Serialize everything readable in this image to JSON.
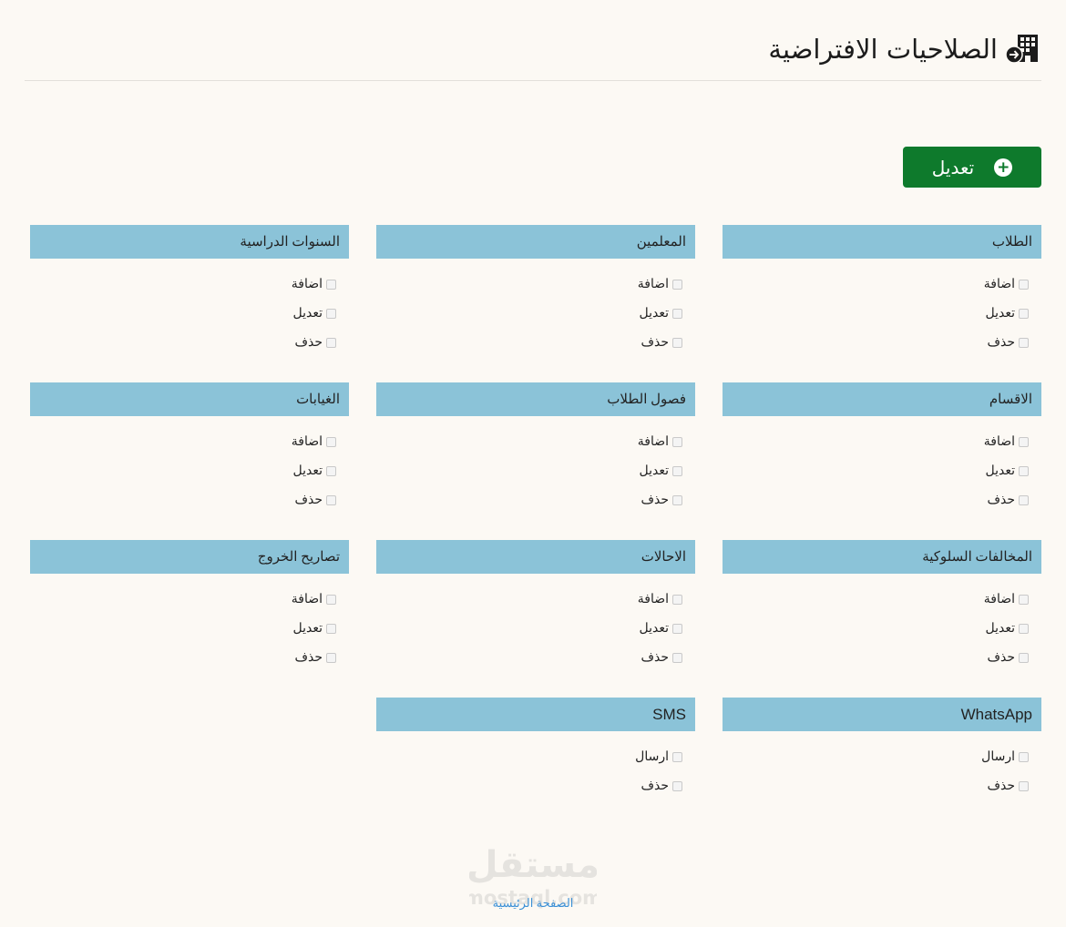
{
  "header": {
    "title": "الصلاحيات الافتراضية"
  },
  "toolbar": {
    "edit_label": "تعديل"
  },
  "panels": [
    {
      "title": "الطلاب",
      "items": [
        "اضافة",
        "تعديل",
        "حذف"
      ]
    },
    {
      "title": "المعلمين",
      "items": [
        "اضافة",
        "تعديل",
        "حذف"
      ]
    },
    {
      "title": "السنوات الدراسية",
      "items": [
        "اضافة",
        "تعديل",
        "حذف"
      ]
    },
    {
      "title": "الاقسام",
      "items": [
        "اضافة",
        "تعديل",
        "حذف"
      ]
    },
    {
      "title": "فصول الطلاب",
      "items": [
        "اضافة",
        "تعديل",
        "حذف"
      ]
    },
    {
      "title": "الغيابات",
      "items": [
        "اضافة",
        "تعديل",
        "حذف"
      ]
    },
    {
      "title": "المخالفات السلوكية",
      "items": [
        "اضافة",
        "تعديل",
        "حذف"
      ]
    },
    {
      "title": "الاحالات",
      "items": [
        "اضافة",
        "تعديل",
        "حذف"
      ]
    },
    {
      "title": "تصاريح الخروج",
      "items": [
        "اضافة",
        "تعديل",
        "حذف"
      ]
    },
    {
      "title": "WhatsApp",
      "items": [
        "ارسال",
        "حذف"
      ]
    },
    {
      "title": "SMS",
      "items": [
        "ارسال",
        "حذف"
      ]
    }
  ],
  "footer": {
    "home_link": "الصفحة الرئيسية"
  },
  "watermark": {
    "text_ar": "مستقل",
    "text_en": "mostaql.com"
  },
  "colors": {
    "background": "#fcf9f4",
    "panel_header": "#8bc3d8",
    "edit_button": "#0e7a2c",
    "link": "#3a8fd6"
  }
}
